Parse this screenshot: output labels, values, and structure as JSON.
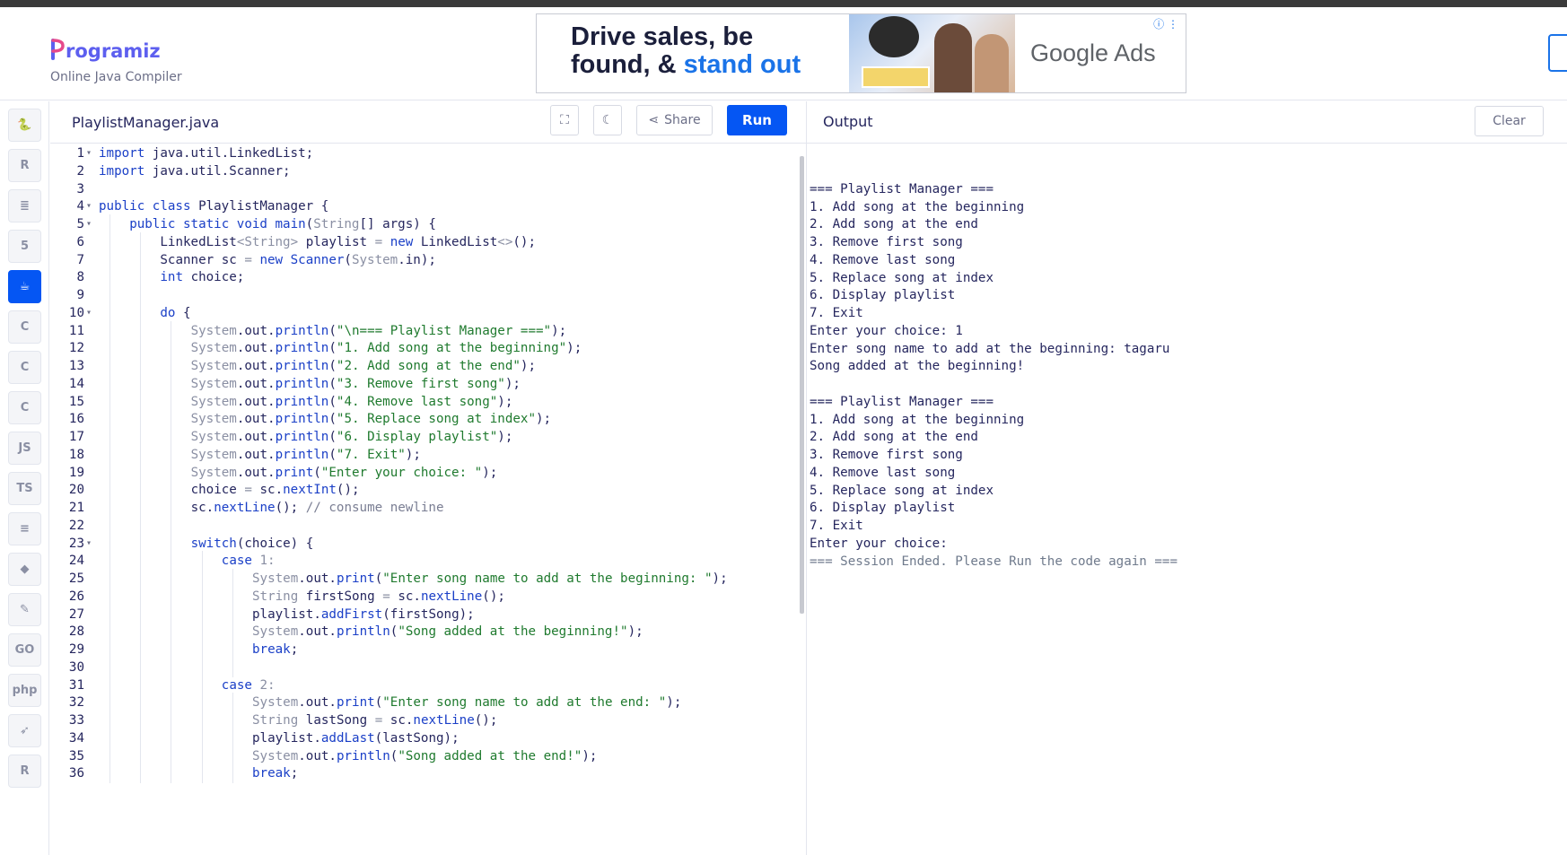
{
  "header": {
    "logo_text": "rogramiz",
    "logo_initial": "P",
    "subtitle": "Online Java Compiler"
  },
  "ad": {
    "headline_line1": "Drive sales, be",
    "headline_line2_prefix": "found, & ",
    "headline_line2_highlight": "stand out",
    "brand": "Google Ads",
    "info_icon": "ⓘ ⋮"
  },
  "sidebar": {
    "items": [
      {
        "name": "python",
        "label": "🐍",
        "active": false
      },
      {
        "name": "r",
        "label": "R",
        "active": false
      },
      {
        "name": "sql",
        "label": "≣",
        "active": false
      },
      {
        "name": "html",
        "label": "5",
        "active": false
      },
      {
        "name": "java",
        "label": "☕",
        "active": true
      },
      {
        "name": "c",
        "label": "C",
        "active": false
      },
      {
        "name": "cpp",
        "label": "C",
        "active": false
      },
      {
        "name": "csharp",
        "label": "C",
        "active": false
      },
      {
        "name": "js",
        "label": "JS",
        "active": false
      },
      {
        "name": "ts",
        "label": "TS",
        "active": false
      },
      {
        "name": "kotlin",
        "label": "≡",
        "active": false
      },
      {
        "name": "scala",
        "label": "◆",
        "active": false
      },
      {
        "name": "rust",
        "label": "✎",
        "active": false
      },
      {
        "name": "go",
        "label": "GO",
        "active": false
      },
      {
        "name": "php",
        "label": "php",
        "active": false
      },
      {
        "name": "swift",
        "label": "➶",
        "active": false
      },
      {
        "name": "ruby",
        "label": "R",
        "active": false
      }
    ]
  },
  "editor": {
    "filename": "PlaylistManager.java",
    "share_label": "Share",
    "run_label": "Run",
    "fullscreen_icon": "⛶",
    "theme_icon": "☾",
    "share_icon": "⋖"
  },
  "output_panel": {
    "title": "Output",
    "clear_label": "Clear",
    "lines": [
      "",
      "=== Playlist Manager ===",
      "1. Add song at the beginning",
      "2. Add song at the end",
      "3. Remove first song",
      "4. Remove last song",
      "5. Replace song at index",
      "6. Display playlist",
      "7. Exit",
      "Enter your choice: 1",
      "Enter song name to add at the beginning: tagaru",
      "Song added at the beginning!",
      "",
      "=== Playlist Manager ===",
      "1. Add song at the beginning",
      "2. Add song at the end",
      "3. Remove first song",
      "4. Remove last song",
      "5. Replace song at index",
      "6. Display playlist",
      "7. Exit",
      "Enter your choice: "
    ],
    "end_line": "=== Session Ended. Please Run the code again ==="
  },
  "code_lines": [
    {
      "n": "1",
      "fold": "▾",
      "indent": 0,
      "tokens": [
        [
          "kw",
          "import"
        ],
        [
          "",
          "java.util.LinkedList;"
        ]
      ]
    },
    {
      "n": "2",
      "fold": "",
      "indent": 0,
      "tokens": [
        [
          "kw",
          "import"
        ],
        [
          "",
          "java.util.Scanner;"
        ]
      ]
    },
    {
      "n": "3",
      "fold": "",
      "indent": 0,
      "tokens": []
    },
    {
      "n": "4",
      "fold": "▾",
      "indent": 0,
      "tokens": [
        [
          "kw",
          "public"
        ],
        [
          "kw",
          "class"
        ],
        [
          "",
          "PlaylistManager {"
        ]
      ]
    },
    {
      "n": "5",
      "fold": "▾",
      "indent": 1,
      "tokens": [
        [
          "kw",
          "public"
        ],
        [
          "kw",
          "static"
        ],
        [
          "kw",
          "void"
        ],
        [
          "meth",
          "main"
        ],
        [
          "",
          "("
        ],
        [
          "type",
          "String"
        ],
        [
          "",
          "[] args) {"
        ]
      ]
    },
    {
      "n": "6",
      "fold": "",
      "indent": 2,
      "tokens": [
        [
          "",
          "LinkedList"
        ],
        [
          "type",
          "<String>"
        ],
        [
          "",
          "playlist"
        ],
        [
          "type",
          "="
        ],
        [
          "kw",
          "new"
        ],
        [
          "",
          "LinkedList"
        ],
        [
          "type",
          "<>"
        ],
        [
          "",
          "();"
        ]
      ]
    },
    {
      "n": "7",
      "fold": "",
      "indent": 2,
      "tokens": [
        [
          "",
          "Scanner sc"
        ],
        [
          "type",
          "="
        ],
        [
          "kw",
          "new"
        ],
        [
          "meth",
          "Scanner"
        ],
        [
          "",
          "("
        ],
        [
          "type",
          "System"
        ],
        [
          "",
          ".in);"
        ]
      ]
    },
    {
      "n": "8",
      "fold": "",
      "indent": 2,
      "tokens": [
        [
          "kw",
          "int"
        ],
        [
          "",
          "choice;"
        ]
      ]
    },
    {
      "n": "9",
      "fold": "",
      "indent": 2,
      "tokens": []
    },
    {
      "n": "10",
      "fold": "▾",
      "indent": 2,
      "tokens": [
        [
          "kw",
          "do"
        ],
        [
          "",
          "{"
        ]
      ]
    },
    {
      "n": "11",
      "fold": "",
      "indent": 3,
      "tokens": [
        [
          "type",
          "System"
        ],
        [
          "",
          ".out."
        ],
        [
          "meth",
          "println"
        ],
        [
          "",
          "("
        ],
        [
          "str",
          "\"\\n=== Playlist Manager ===\""
        ],
        [
          "",
          ");"
        ]
      ]
    },
    {
      "n": "12",
      "fold": "",
      "indent": 3,
      "tokens": [
        [
          "type",
          "System"
        ],
        [
          "",
          ".out."
        ],
        [
          "meth",
          "println"
        ],
        [
          "",
          "("
        ],
        [
          "str",
          "\"1. Add song at the beginning\""
        ],
        [
          "",
          ");"
        ]
      ]
    },
    {
      "n": "13",
      "fold": "",
      "indent": 3,
      "tokens": [
        [
          "type",
          "System"
        ],
        [
          "",
          ".out."
        ],
        [
          "meth",
          "println"
        ],
        [
          "",
          "("
        ],
        [
          "str",
          "\"2. Add song at the end\""
        ],
        [
          "",
          ");"
        ]
      ]
    },
    {
      "n": "14",
      "fold": "",
      "indent": 3,
      "tokens": [
        [
          "type",
          "System"
        ],
        [
          "",
          ".out."
        ],
        [
          "meth",
          "println"
        ],
        [
          "",
          "("
        ],
        [
          "str",
          "\"3. Remove first song\""
        ],
        [
          "",
          ");"
        ]
      ]
    },
    {
      "n": "15",
      "fold": "",
      "indent": 3,
      "tokens": [
        [
          "type",
          "System"
        ],
        [
          "",
          ".out."
        ],
        [
          "meth",
          "println"
        ],
        [
          "",
          "("
        ],
        [
          "str",
          "\"4. Remove last song\""
        ],
        [
          "",
          ");"
        ]
      ]
    },
    {
      "n": "16",
      "fold": "",
      "indent": 3,
      "tokens": [
        [
          "type",
          "System"
        ],
        [
          "",
          ".out."
        ],
        [
          "meth",
          "println"
        ],
        [
          "",
          "("
        ],
        [
          "str",
          "\"5. Replace song at index\""
        ],
        [
          "",
          ");"
        ]
      ]
    },
    {
      "n": "17",
      "fold": "",
      "indent": 3,
      "tokens": [
        [
          "type",
          "System"
        ],
        [
          "",
          ".out."
        ],
        [
          "meth",
          "println"
        ],
        [
          "",
          "("
        ],
        [
          "str",
          "\"6. Display playlist\""
        ],
        [
          "",
          ");"
        ]
      ]
    },
    {
      "n": "18",
      "fold": "",
      "indent": 3,
      "tokens": [
        [
          "type",
          "System"
        ],
        [
          "",
          ".out."
        ],
        [
          "meth",
          "println"
        ],
        [
          "",
          "("
        ],
        [
          "str",
          "\"7. Exit\""
        ],
        [
          "",
          ");"
        ]
      ]
    },
    {
      "n": "19",
      "fold": "",
      "indent": 3,
      "tokens": [
        [
          "type",
          "System"
        ],
        [
          "",
          ".out."
        ],
        [
          "meth",
          "print"
        ],
        [
          "",
          "("
        ],
        [
          "str",
          "\"Enter your choice: \""
        ],
        [
          "",
          ");"
        ]
      ]
    },
    {
      "n": "20",
      "fold": "",
      "indent": 3,
      "tokens": [
        [
          "",
          "choice"
        ],
        [
          "type",
          "="
        ],
        [
          "",
          "sc."
        ],
        [
          "meth",
          "nextInt"
        ],
        [
          "",
          "();"
        ]
      ]
    },
    {
      "n": "21",
      "fold": "",
      "indent": 3,
      "tokens": [
        [
          "",
          "sc."
        ],
        [
          "meth",
          "nextLine"
        ],
        [
          "",
          "();"
        ],
        [
          "cmt",
          "// consume newline"
        ]
      ]
    },
    {
      "n": "22",
      "fold": "",
      "indent": 3,
      "tokens": []
    },
    {
      "n": "23",
      "fold": "▾",
      "indent": 3,
      "tokens": [
        [
          "kw",
          "switch"
        ],
        [
          "",
          "(choice) {"
        ]
      ]
    },
    {
      "n": "24",
      "fold": "",
      "indent": 4,
      "tokens": [
        [
          "kw",
          "case"
        ],
        [
          "type",
          "1:"
        ]
      ]
    },
    {
      "n": "25",
      "fold": "",
      "indent": 5,
      "tokens": [
        [
          "type",
          "System"
        ],
        [
          "",
          ".out."
        ],
        [
          "meth",
          "print"
        ],
        [
          "",
          "("
        ],
        [
          "str",
          "\"Enter song name to add at the beginning: \""
        ],
        [
          "",
          ");"
        ]
      ]
    },
    {
      "n": "26",
      "fold": "",
      "indent": 5,
      "tokens": [
        [
          "type",
          "String"
        ],
        [
          "",
          "firstSong"
        ],
        [
          "type",
          "="
        ],
        [
          "",
          "sc."
        ],
        [
          "meth",
          "nextLine"
        ],
        [
          "",
          "();"
        ]
      ]
    },
    {
      "n": "27",
      "fold": "",
      "indent": 5,
      "tokens": [
        [
          "",
          "playlist."
        ],
        [
          "meth",
          "addFirst"
        ],
        [
          "",
          "(firstSong);"
        ]
      ]
    },
    {
      "n": "28",
      "fold": "",
      "indent": 5,
      "tokens": [
        [
          "type",
          "System"
        ],
        [
          "",
          ".out."
        ],
        [
          "meth",
          "println"
        ],
        [
          "",
          "("
        ],
        [
          "str",
          "\"Song added at the beginning!\""
        ],
        [
          "",
          ");"
        ]
      ]
    },
    {
      "n": "29",
      "fold": "",
      "indent": 5,
      "tokens": [
        [
          "kw",
          "break"
        ],
        [
          "",
          ";"
        ]
      ]
    },
    {
      "n": "30",
      "fold": "",
      "indent": 5,
      "tokens": []
    },
    {
      "n": "31",
      "fold": "",
      "indent": 4,
      "tokens": [
        [
          "kw",
          "case"
        ],
        [
          "type",
          "2:"
        ]
      ]
    },
    {
      "n": "32",
      "fold": "",
      "indent": 5,
      "tokens": [
        [
          "type",
          "System"
        ],
        [
          "",
          ".out."
        ],
        [
          "meth",
          "print"
        ],
        [
          "",
          "("
        ],
        [
          "str",
          "\"Enter song name to add at the end: \""
        ],
        [
          "",
          ");"
        ]
      ]
    },
    {
      "n": "33",
      "fold": "",
      "indent": 5,
      "tokens": [
        [
          "type",
          "String"
        ],
        [
          "",
          "lastSong"
        ],
        [
          "type",
          "="
        ],
        [
          "",
          "sc."
        ],
        [
          "meth",
          "nextLine"
        ],
        [
          "",
          "();"
        ]
      ]
    },
    {
      "n": "34",
      "fold": "",
      "indent": 5,
      "tokens": [
        [
          "",
          "playlist."
        ],
        [
          "meth",
          "addLast"
        ],
        [
          "",
          "(lastSong);"
        ]
      ]
    },
    {
      "n": "35",
      "fold": "",
      "indent": 5,
      "tokens": [
        [
          "type",
          "System"
        ],
        [
          "",
          ".out."
        ],
        [
          "meth",
          "println"
        ],
        [
          "",
          "("
        ],
        [
          "str",
          "\"Song added at the end!\""
        ],
        [
          "",
          ");"
        ]
      ]
    },
    {
      "n": "36",
      "fold": "",
      "indent": 5,
      "tokens": [
        [
          "kw",
          "break"
        ],
        [
          "",
          ";"
        ]
      ]
    }
  ]
}
